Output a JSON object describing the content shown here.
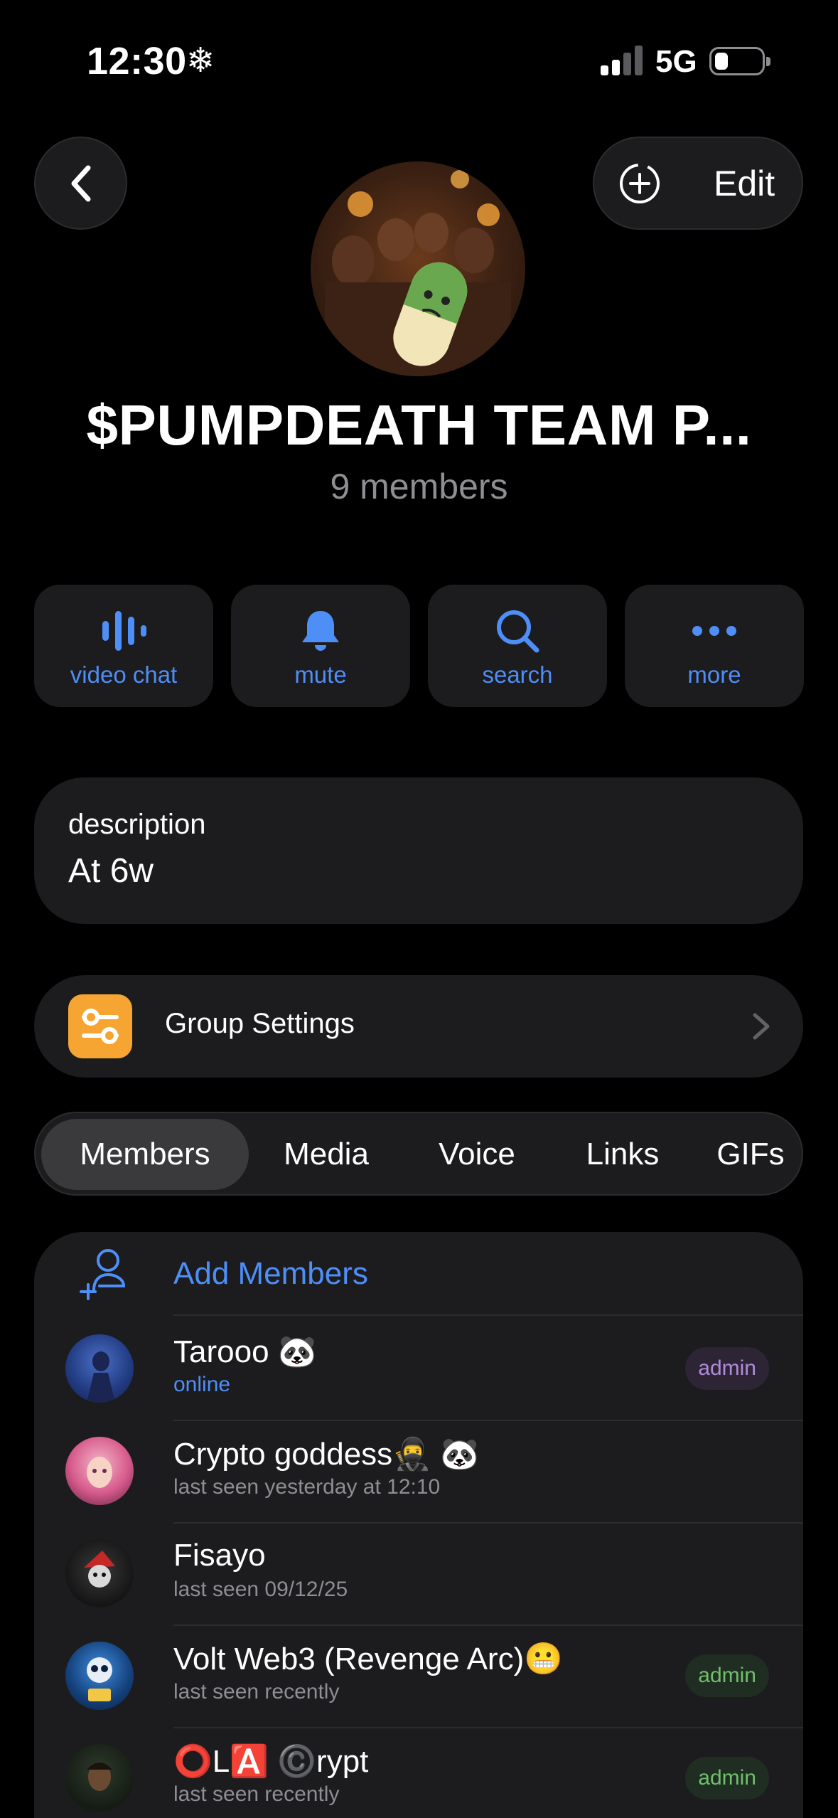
{
  "status_bar": {
    "time": "12:30",
    "time_icon": "snowflake-icon",
    "network": "5G"
  },
  "header": {
    "edit_label": "Edit"
  },
  "group": {
    "title": "$PUMPDEATH TEAM P...",
    "members_count": "9 members"
  },
  "actions": [
    {
      "label": "video chat",
      "icon": "video-chat-icon"
    },
    {
      "label": "mute",
      "icon": "bell-icon"
    },
    {
      "label": "search",
      "icon": "search-icon"
    },
    {
      "label": "more",
      "icon": "more-icon"
    }
  ],
  "description": {
    "label": "description",
    "value": "At 6w"
  },
  "settings": {
    "label": "Group Settings"
  },
  "tabs": [
    "Members",
    "Media",
    "Voice",
    "Links",
    "GIFs"
  ],
  "members_section": {
    "add_label": "Add Members",
    "members": [
      {
        "name": "Tarooo 🐼",
        "status": "online",
        "badge": "admin"
      },
      {
        "name": "Crypto goddess🥷 🐼",
        "status": "last seen yesterday at 12:10",
        "badge": ""
      },
      {
        "name": "Fisayo",
        "status": "last seen 09/12/25",
        "badge": ""
      },
      {
        "name": "Volt Web3 (Revenge Arc)😬",
        "status": "last seen recently",
        "badge": "admin"
      },
      {
        "name": "⭕L🅰️ ©️rypt",
        "status": "last seen recently",
        "badge": "admin"
      }
    ]
  },
  "colors": {
    "accent": "#4e8ef7",
    "background": "#000000",
    "card": "#1c1c1e",
    "settings_icon": "#f7a532"
  }
}
